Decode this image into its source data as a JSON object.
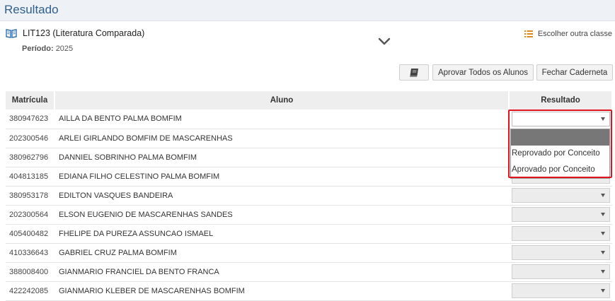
{
  "header": {
    "title": "Resultado"
  },
  "class_info": {
    "course": "LIT123 (Literatura Comparada)",
    "period_label": "Período:",
    "period_value": "2025"
  },
  "other_class_link": "Escolher outra classe",
  "buttons": {
    "approve_all": "Aprovar Todos os Alunos",
    "close_book": "Fechar Caderneta"
  },
  "table": {
    "columns": [
      "Matrícula",
      "Aluno",
      "Resultado"
    ],
    "rows": [
      {
        "matricula": "380947623",
        "aluno": "AILLA DA BENTO PALMA BOMFIM"
      },
      {
        "matricula": "202300546",
        "aluno": "ARLEI GIRLANDO BOMFIM DE MASCARENHAS"
      },
      {
        "matricula": "380962796",
        "aluno": "DANNIEL SOBRINHO PALMA BOMFIM"
      },
      {
        "matricula": "404813185",
        "aluno": "EDIANA FILHO CELESTINO PALMA BOMFIM"
      },
      {
        "matricula": "380953178",
        "aluno": "EDILTON VASQUES BANDEIRA"
      },
      {
        "matricula": "202300564",
        "aluno": "ELSON EUGENIO DE MASCARENHAS SANDES"
      },
      {
        "matricula": "405400482",
        "aluno": "FHELIPE DA PUREZA ASSUNCAO ISMAEL"
      },
      {
        "matricula": "410336643",
        "aluno": "GABRIEL CRUZ PALMA BOMFIM"
      },
      {
        "matricula": "388008400",
        "aluno": "GIANMARIO FRANCIEL DA BENTO FRANCA"
      },
      {
        "matricula": "422242085",
        "aluno": "GIANMARIO KLEBER DE MASCARENHAS BOMFIM"
      }
    ]
  },
  "dropdown": {
    "options": [
      "",
      "Reprovado por Conceito",
      "Aprovado por Conceito"
    ],
    "highlighted_index": 0
  },
  "colors": {
    "title": "#2f5f8f",
    "header_bg": "#eef1f5",
    "highlight_border": "#e0141e",
    "option_selected_bg": "#777777",
    "icon_blue": "#2f6fb0",
    "icon_orange": "#e08a1e"
  },
  "icons": {
    "class_icon": "open-book-icon",
    "expand": "chevron-down-icon",
    "other_class": "list-icon",
    "book_button": "book-icon",
    "select_arrow": "caret-down-icon"
  }
}
